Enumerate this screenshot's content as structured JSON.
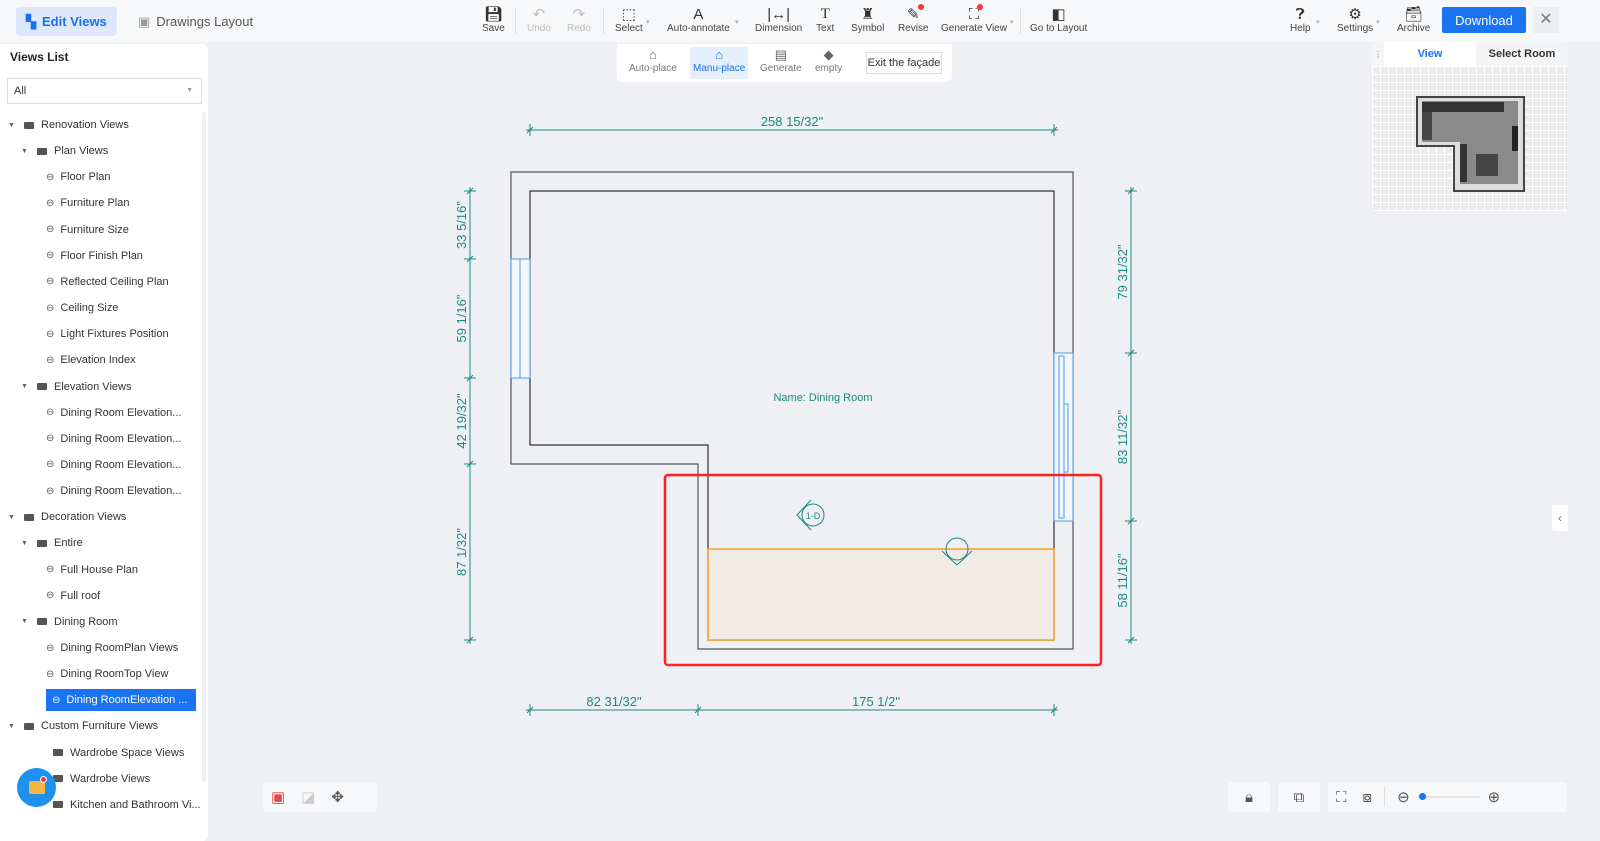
{
  "header": {
    "tabs": [
      {
        "label": "Edit Views",
        "active": true
      },
      {
        "label": "Drawings Layout",
        "active": false
      }
    ],
    "tools": {
      "save": "Save",
      "undo": "Undo",
      "redo": "Redo",
      "select": "Select",
      "auto_annotate": "Auto-annotate",
      "dimension": "Dimension",
      "text": "Text",
      "symbol": "Symbol",
      "revise": "Revise",
      "generate_view": "Generate View",
      "go_to_layout": "Go to Layout",
      "help": "Help",
      "settings": "Settings",
      "archive": "Archive"
    },
    "download": "Download",
    "accent": "#1a73f0"
  },
  "subtoolbar": {
    "auto_place": "Auto-place",
    "manu_place": "Manu-place",
    "generate": "Generate",
    "empty": "empty",
    "exit": "Exit the façade"
  },
  "sidebar": {
    "title": "Views List",
    "filter": "All",
    "tree": [
      {
        "label": "Renovation Views",
        "level": 0,
        "type": "folder"
      },
      {
        "label": "Plan Views",
        "level": 1,
        "type": "folder"
      },
      {
        "label": "Floor Plan",
        "level": 2,
        "type": "view"
      },
      {
        "label": "Furniture Plan",
        "level": 2,
        "type": "view"
      },
      {
        "label": "Furniture Size",
        "level": 2,
        "type": "view"
      },
      {
        "label": "Floor Finish Plan",
        "level": 2,
        "type": "view"
      },
      {
        "label": "Reflected Ceiling Plan",
        "level": 2,
        "type": "view"
      },
      {
        "label": "Ceiling Size",
        "level": 2,
        "type": "view"
      },
      {
        "label": "Light Fixtures Position",
        "level": 2,
        "type": "view"
      },
      {
        "label": "Elevation Index",
        "level": 2,
        "type": "view"
      },
      {
        "label": "Elevation Views",
        "level": 1,
        "type": "folder"
      },
      {
        "label": "Dining Room Elevation...",
        "level": 2,
        "type": "view"
      },
      {
        "label": "Dining Room Elevation...",
        "level": 2,
        "type": "view"
      },
      {
        "label": "Dining Room Elevation...",
        "level": 2,
        "type": "view"
      },
      {
        "label": "Dining Room Elevation...",
        "level": 2,
        "type": "view"
      },
      {
        "label": "Decoration Views",
        "level": 0,
        "type": "folder"
      },
      {
        "label": "Entire",
        "level": 1,
        "type": "folder"
      },
      {
        "label": "Full House Plan",
        "level": 2,
        "type": "view"
      },
      {
        "label": "Full roof",
        "level": 2,
        "type": "view"
      },
      {
        "label": "Dining Room",
        "level": 1,
        "type": "folder"
      },
      {
        "label": "Dining RoomPlan Views",
        "level": 2,
        "type": "view"
      },
      {
        "label": "Dining RoomTop View",
        "level": 2,
        "type": "view"
      },
      {
        "label": "Dining RoomElevation ...",
        "level": 2,
        "type": "view",
        "selected": true
      },
      {
        "label": "Custom Furniture Views",
        "level": 0,
        "type": "folder"
      },
      {
        "label": "Wardrobe Space Views",
        "level": 1,
        "type": "folder",
        "leaf": true
      },
      {
        "label": "Wardrobe Views",
        "level": 1,
        "type": "folder",
        "leaf": true
      },
      {
        "label": "Kitchen and Bathroom Vi...",
        "level": 1,
        "type": "folder",
        "leaf": true
      }
    ]
  },
  "minimap": {
    "tabs": [
      "View",
      "Select Room"
    ],
    "active": "View"
  },
  "drawing": {
    "room_name": "Name: Dining Room",
    "elevation_tag": "1-D",
    "dims": {
      "top": "258 15/32\"",
      "left": [
        "33 5/16\"",
        "59 1/16\"",
        "42 19/32\"",
        "87 1/32\""
      ],
      "right": [
        "79 31/32\"",
        "83 11/32\"",
        "58 11/16\""
      ],
      "bottom": [
        "82 31/32\"",
        "175 1/2\""
      ]
    },
    "colors": {
      "dimension": "#1a8a80",
      "window": "#4a9af0",
      "selection": "#f5a030",
      "highlight": "#ff2020"
    }
  },
  "zoom": {
    "level": 0.02
  }
}
